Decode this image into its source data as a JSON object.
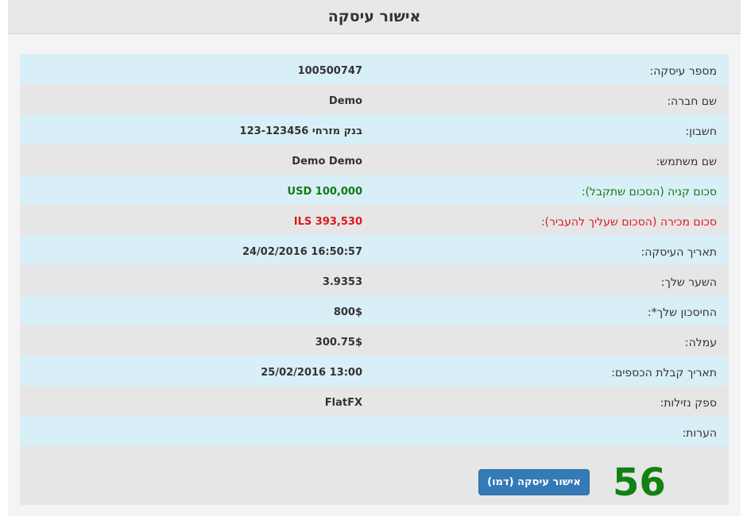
{
  "header": {
    "title": "אישור עיסקה"
  },
  "details": [
    {
      "label": "מספר עיסקה:",
      "value": "100500747",
      "style": "normal"
    },
    {
      "label": "שם חברה:",
      "value": "Demo",
      "style": "normal"
    },
    {
      "label": "חשבון:",
      "value": "בנק מזרחי 123-123456",
      "style": "normal"
    },
    {
      "label": "שם משתמש:",
      "value": "Demo Demo",
      "style": "normal"
    },
    {
      "label": "סכום קניה (הסכום שתקבל):",
      "value": "USD 100,000",
      "style": "green"
    },
    {
      "label": "סכום מכירה (הסכום שעליך להעביר):",
      "value": "ILS 393,530",
      "style": "red"
    },
    {
      "label": "תאריך העיסקה:",
      "value": "24/02/2016 16:50:57",
      "style": "normal"
    },
    {
      "label": "השער שלך:",
      "value": "3.9353",
      "style": "normal"
    },
    {
      "label": "החיסכון שלך*:",
      "value": "800$",
      "style": "normal"
    },
    {
      "label": "עמלה:",
      "value": "300.75$",
      "style": "normal"
    },
    {
      "label": "תאריך קבלת הכספים:",
      "value": "25/02/2016 13:00",
      "style": "normal"
    },
    {
      "label": "ספק נזילות:",
      "value": "FlatFX",
      "style": "normal"
    },
    {
      "label": "הערות:",
      "value": "",
      "style": "normal"
    }
  ],
  "actions": {
    "confirm_label": "אישור עיסקה (דמו)",
    "countdown": "56"
  },
  "colors": {
    "row_blue": "#d9eff7",
    "row_gray": "#e6e6e6",
    "green": "#127a12",
    "red": "#e0161b",
    "button": "#337ab7"
  }
}
